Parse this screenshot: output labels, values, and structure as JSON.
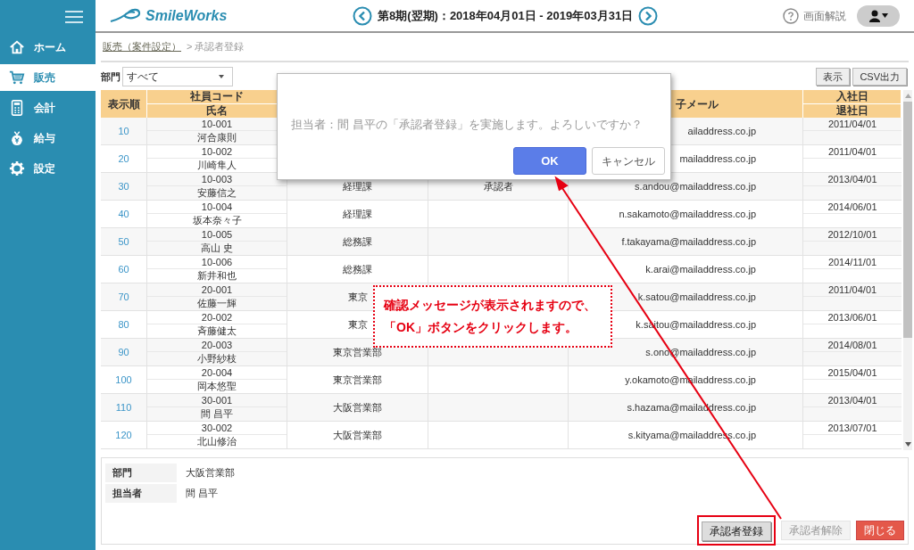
{
  "sidebar": {
    "items": [
      {
        "label": "ホーム",
        "kind": "home",
        "selected": false
      },
      {
        "label": "販売",
        "kind": "cart",
        "selected": true
      },
      {
        "label": "会計",
        "kind": "calc",
        "selected": false
      },
      {
        "label": "給与",
        "kind": "money",
        "selected": false
      },
      {
        "label": "設定",
        "kind": "gear",
        "selected": false
      }
    ]
  },
  "header": {
    "logo": "SmileWorks",
    "period": "第8期(翌期)：2018年04月01日 - 2019年03月31日",
    "help": "画面解説"
  },
  "breadcrumb": {
    "link": "販売（案件設定）",
    "current": "> 承認者登録"
  },
  "filter": {
    "label": "部門",
    "value": "すべて"
  },
  "toolbar": [
    "表示",
    "CSV出力"
  ],
  "table": {
    "columns": [
      {
        "lines": [
          "表示順"
        ]
      },
      {
        "lines": [
          "社員コード",
          "氏名"
        ]
      },
      {},
      {},
      {
        "lines": [
          "子メール"
        ]
      },
      {
        "lines": [
          "入社日",
          "退社日"
        ]
      }
    ],
    "rows": [
      {
        "order": "10",
        "code": "10-001",
        "name": "河合康則",
        "email": "ailaddress.co.jp",
        "joined": "2011/04/01"
      },
      {
        "order": "20",
        "code": "10-002",
        "name": "川崎隼人",
        "email": "mailaddress.co.jp",
        "joined": "2011/04/01"
      },
      {
        "order": "30",
        "code": "10-003",
        "name": "安藤信之",
        "dept": "経理課",
        "role": "承認者",
        "email": "s.andou@mailaddress.co.jp",
        "joined": "2013/04/01"
      },
      {
        "order": "40",
        "code": "10-004",
        "name": "坂本奈々子",
        "dept": "経理課",
        "email": "n.sakamoto@mailaddress.co.jp",
        "joined": "2014/06/01"
      },
      {
        "order": "50",
        "code": "10-005",
        "name": "高山 史",
        "dept": "総務課",
        "email": "f.takayama@mailaddress.co.jp",
        "joined": "2012/10/01"
      },
      {
        "order": "60",
        "code": "10-006",
        "name": "新井和也",
        "dept": "総務課",
        "email": "k.arai@mailaddress.co.jp",
        "joined": "2014/11/01"
      },
      {
        "order": "70",
        "code": "20-001",
        "name": "佐藤一輝",
        "dept": "東京",
        "email": "k.satou@mailaddress.co.jp",
        "joined": "2011/04/01"
      },
      {
        "order": "80",
        "code": "20-002",
        "name": "斉藤健太",
        "dept": "東京",
        "email": "k.saitou@mailaddress.co.jp",
        "joined": "2013/06/01"
      },
      {
        "order": "90",
        "code": "20-003",
        "name": "小野紗枝",
        "dept": "東京営業部",
        "email": "s.ono@mailaddress.co.jp",
        "joined": "2014/08/01"
      },
      {
        "order": "100",
        "code": "20-004",
        "name": "岡本悠聖",
        "dept": "東京営業部",
        "email": "y.okamoto@mailaddress.co.jp",
        "joined": "2015/04/01"
      },
      {
        "order": "110",
        "code": "30-001",
        "name": "間 昌平",
        "dept": "大阪営業部",
        "email": "s.hazama@mailaddress.co.jp",
        "joined": "2013/04/01"
      },
      {
        "order": "120",
        "code": "30-002",
        "name": "北山修治",
        "dept": "大阪営業部",
        "email": "s.kityama@mailaddress.co.jp",
        "joined": "2013/07/01"
      }
    ]
  },
  "details": [
    {
      "label": "部門",
      "value": "大阪営業部"
    },
    {
      "label": "担当者",
      "value": "間 昌平"
    }
  ],
  "actions": [
    {
      "label": "承認者登録",
      "kind": "default",
      "disabled": false,
      "highlighted": true
    },
    {
      "label": "承認者解除",
      "kind": "default",
      "disabled": true,
      "highlighted": false
    },
    {
      "label": "閉じる",
      "kind": "danger",
      "disabled": false,
      "highlighted": false
    }
  ],
  "dialog": {
    "message": "担当者：間 昌平の「承認者登録」を実施します。よろしいですか？",
    "ok": "OK",
    "cancel": "キャンセル"
  },
  "callout": {
    "lines": [
      "確認メッセージが表示されますので、",
      "「OK」ボタンをクリックします。"
    ]
  }
}
